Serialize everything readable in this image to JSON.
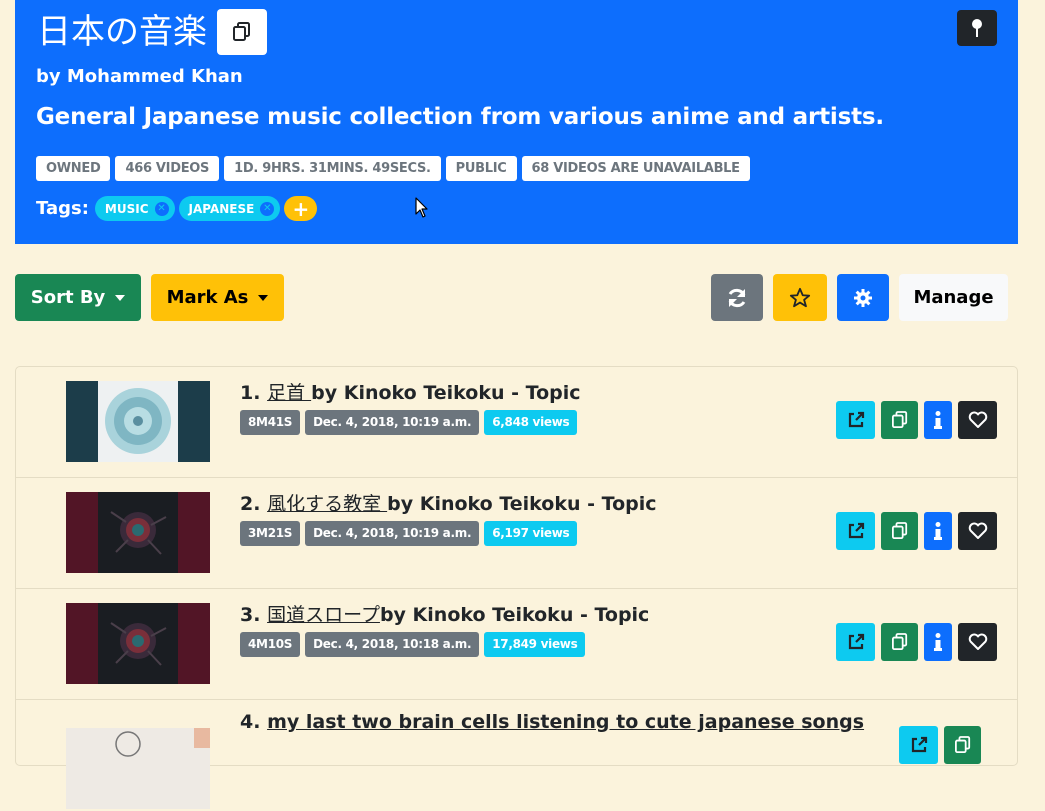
{
  "playlist": {
    "title": "日本の音楽",
    "author": "by Mohammed Khan",
    "description": "General Japanese music collection from various anime and artists.",
    "badges": [
      "OWNED",
      "466 VIDEOS",
      "1D. 9HRS. 31MINS. 49SECS.",
      "PUBLIC",
      "68 VIDEOS ARE UNAVAILABLE"
    ],
    "tags_label": "Tags:",
    "tags": [
      "MUSIC",
      "JAPANESE"
    ],
    "add_tag_label": "+"
  },
  "toolbar": {
    "sort_label": "Sort By",
    "mark_label": "Mark As",
    "manage_label": "Manage"
  },
  "videos": [
    {
      "number": "1.",
      "title": "足首 ",
      "by": "by Kinoko Teikoku - Topic",
      "duration": "8M41S",
      "date": "Dec. 4, 2018, 10:19 a.m.",
      "views": "6,848 views"
    },
    {
      "number": "2.",
      "title": "風化する教室 ",
      "by": "by Kinoko Teikoku - Topic",
      "duration": "3M21S",
      "date": "Dec. 4, 2018, 10:19 a.m.",
      "views": "6,197 views"
    },
    {
      "number": "3.",
      "title": "国道スロープ",
      "by": "by Kinoko Teikoku - Topic",
      "duration": "4M10S",
      "date": "Dec. 4, 2018, 10:18 a.m.",
      "views": "17,849 views"
    },
    {
      "number": "4.",
      "title": "my last two brain cells listening to cute japanese songs"
    }
  ],
  "colors": {
    "header_bg": "#0d6efd",
    "page_bg": "#fbf3dc",
    "success": "#198754",
    "warning": "#ffc107",
    "info": "#0dcaf0",
    "secondary": "#6c757d",
    "dark": "#212529"
  }
}
